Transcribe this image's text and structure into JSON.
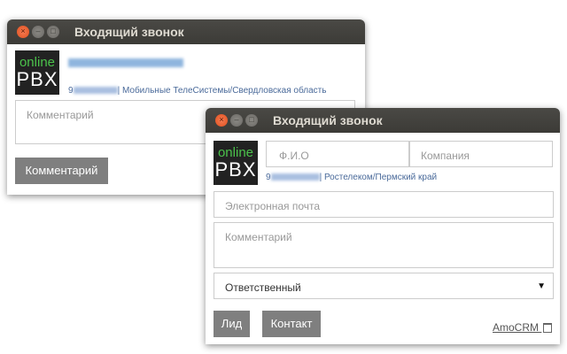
{
  "window1": {
    "title": "Входящий звонок",
    "logo": {
      "top": "online",
      "bottom": "PBX"
    },
    "phone_prefix": "9",
    "operator": "| Мобильные ТелеСистемы/Свердловская область",
    "comment_placeholder": "Комментарий",
    "comment_button": "Комментарий"
  },
  "window2": {
    "title": "Входящий звонок",
    "logo": {
      "top": "online",
      "bottom": "PBX"
    },
    "name_placeholder": "Ф.И.О",
    "company_placeholder": "Компания",
    "phone_prefix": "9",
    "operator": "| Ростелеком/Пермский край",
    "email_placeholder": "Электронная почта",
    "comment_placeholder": "Комментарий",
    "responsible_select": "Ответственный",
    "lead_button": "Лид",
    "contact_button": "Контакт",
    "amocrm_link": "AmoCRM"
  },
  "controls": {
    "close": "×",
    "minimize": "–",
    "maximize": "□"
  }
}
